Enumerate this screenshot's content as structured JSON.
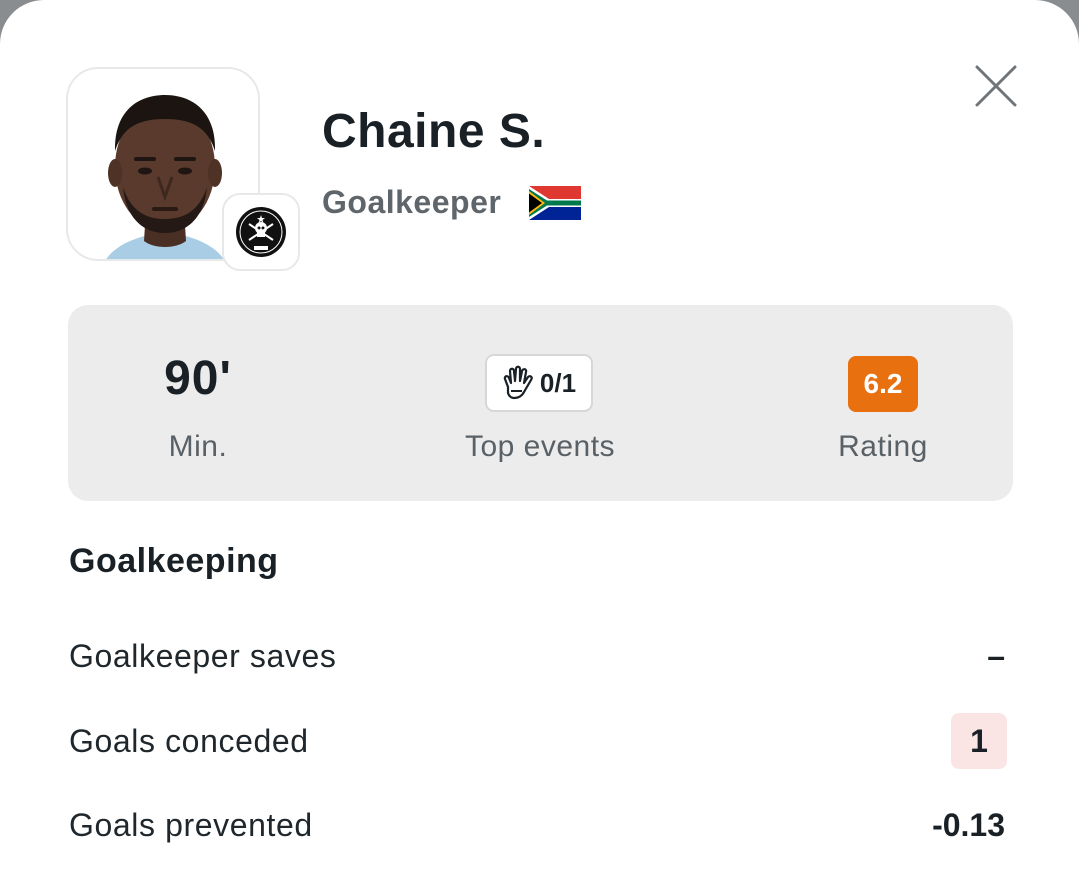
{
  "player": {
    "name": "Chaine S.",
    "position": "Goalkeeper",
    "nationality_flag_icon": "south-africa-flag-icon",
    "club_badge_icon": "orlando-pirates-crest-icon"
  },
  "summary": {
    "minutes_value": "90'",
    "minutes_label": "Min.",
    "top_events_icon": "goalkeeper-glove-icon",
    "top_events_value": "0/1",
    "top_events_label": "Top events",
    "rating_value": "6.2",
    "rating_label": "Rating",
    "rating_color": "#e8700f"
  },
  "section": {
    "title": "Goalkeeping"
  },
  "stats": [
    {
      "label": "Goalkeeper saves",
      "value": "–"
    },
    {
      "label": "Goals conceded",
      "value": "1",
      "highlight_color": "#fbe4e4"
    },
    {
      "label": "Goals prevented",
      "value": "-0.13"
    }
  ],
  "close_icon": "close-icon"
}
